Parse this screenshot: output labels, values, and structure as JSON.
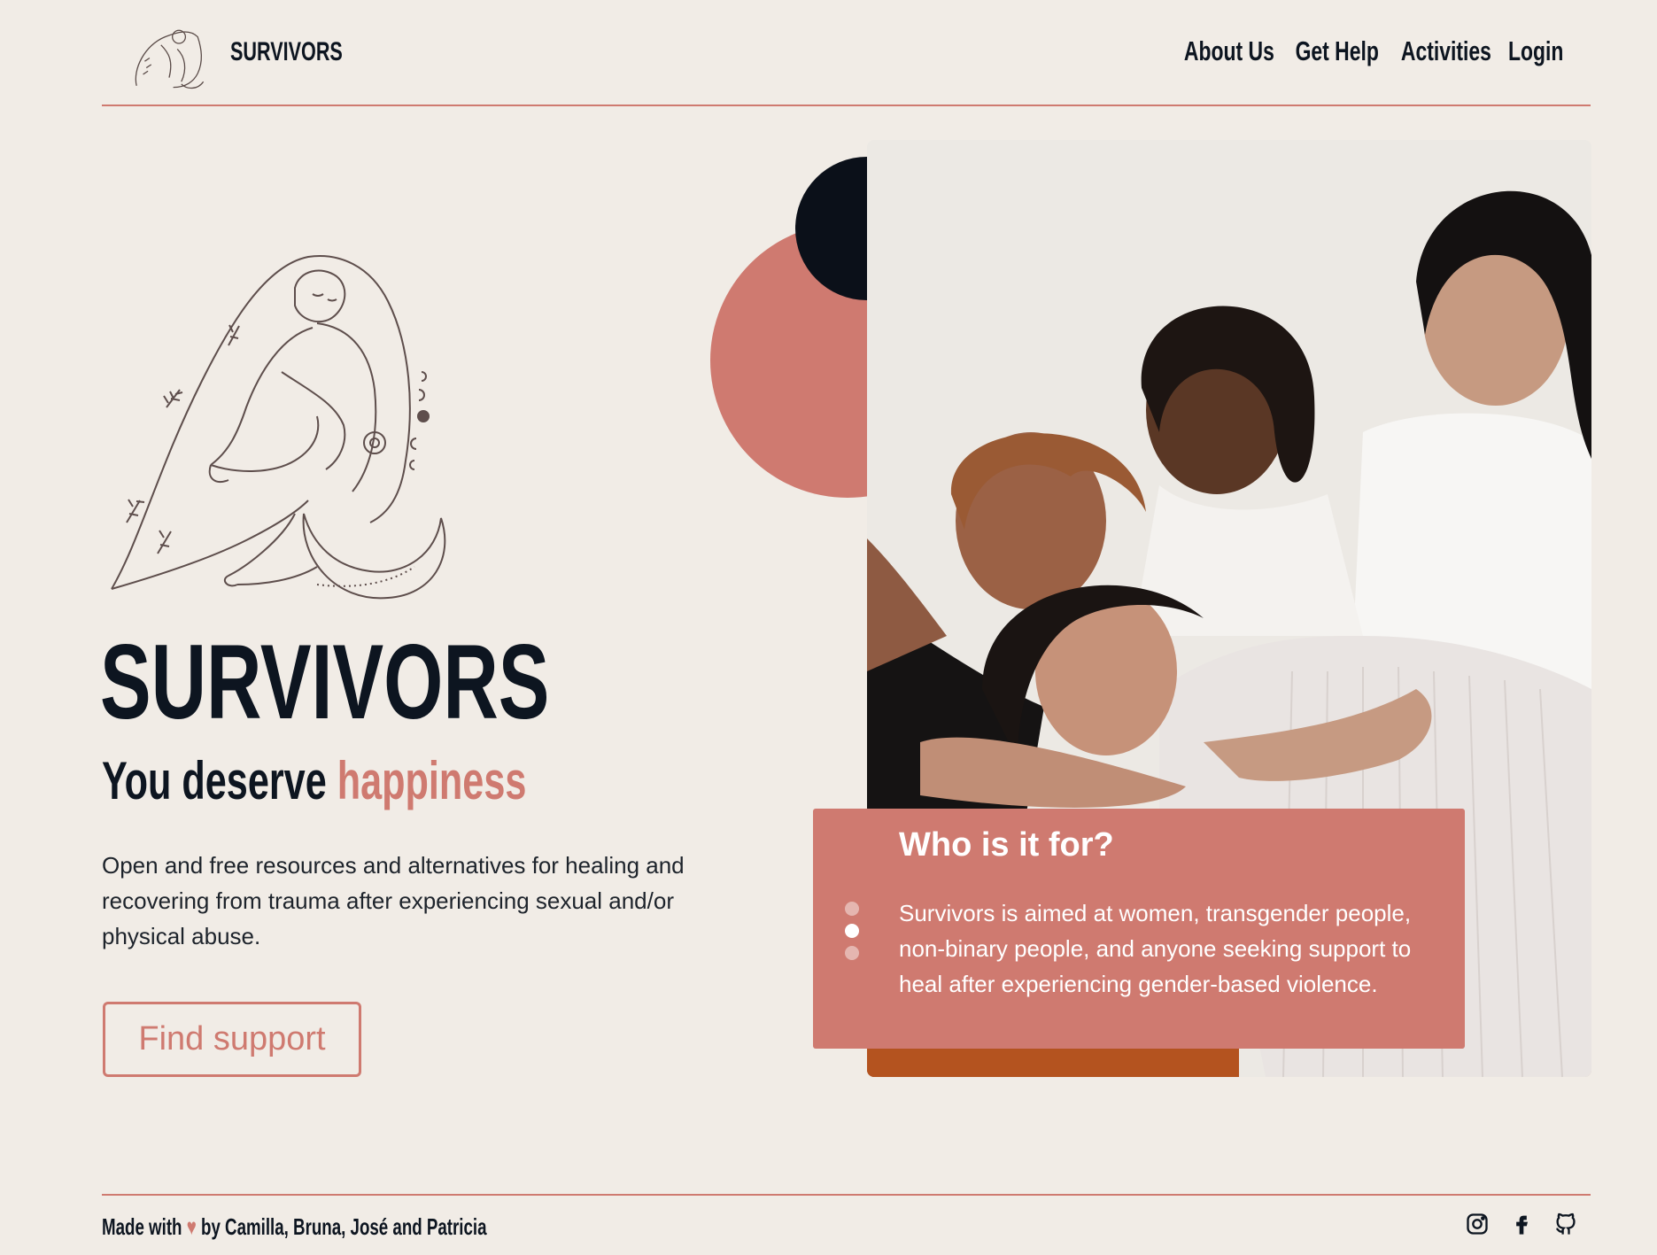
{
  "header": {
    "brand": "SURVIVORS",
    "nav": [
      "About Us",
      "Get Help",
      "Activities",
      "Login"
    ]
  },
  "hero": {
    "title": "SURVIVORS",
    "subtitle_prefix": "You deserve ",
    "subtitle_accent": "happiness",
    "description": "Open and free resources and alternatives for healing and recovering from trauma after experiencing sexual and/or physical abuse.",
    "cta_label": "Find support"
  },
  "info": {
    "title": "Who is it for?",
    "text": "Survivors is aimed at women, transgender people, non-binary people, and anyone seeking support to heal after experiencing gender-based violence.",
    "active_slide": 2,
    "slide_count": 3
  },
  "footer": {
    "credits_prefix": "Made with ",
    "credits_suffix": " by Camilla, Bruna, José and Patricia",
    "heart_icon": "heart-icon",
    "social_icons": [
      "instagram-icon",
      "facebook-icon",
      "github-icon"
    ]
  },
  "colors": {
    "background": "#f1ece6",
    "accent": "#cf7a70",
    "dark": "#0b1019"
  }
}
